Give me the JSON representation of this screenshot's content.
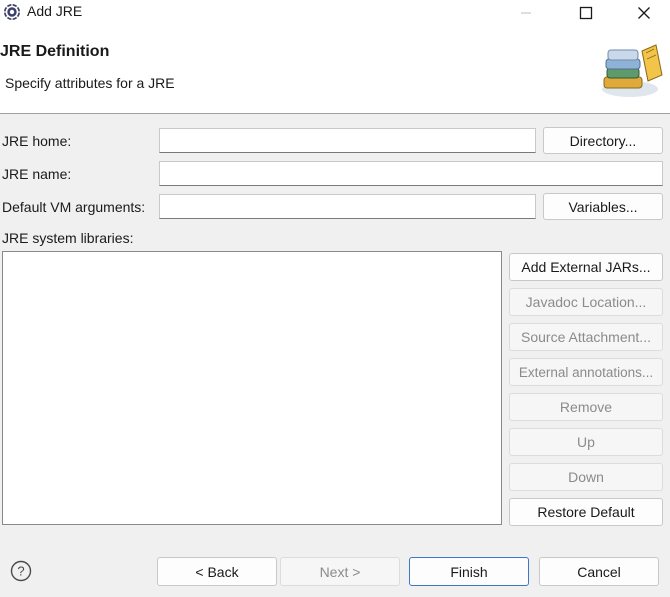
{
  "window": {
    "title": "Add JRE"
  },
  "header": {
    "title": "JRE Definition",
    "description": "Specify attributes for a JRE"
  },
  "form": {
    "jre_home_label": "JRE home:",
    "jre_home_value": "",
    "directory_button": "Directory...",
    "jre_name_label": "JRE name:",
    "jre_name_value": "",
    "vm_args_label": "Default VM arguments:",
    "vm_args_value": "",
    "variables_button": "Variables...",
    "libraries_label": "JRE system libraries:",
    "libraries": []
  },
  "library_buttons": {
    "add_external_jars": "Add External JARs...",
    "javadoc_location": "Javadoc Location...",
    "source_attachment": "Source Attachment...",
    "external_annotations": "External annotations...",
    "remove": "Remove",
    "up": "Up",
    "down": "Down",
    "restore_default": "Restore Default"
  },
  "footer": {
    "back": "< Back",
    "next": "Next >",
    "finish": "Finish",
    "cancel": "Cancel"
  },
  "colors": {
    "background": "#f0f0f0",
    "default_button_border": "#3c78c8",
    "disabled_text": "#8b8b8b"
  }
}
